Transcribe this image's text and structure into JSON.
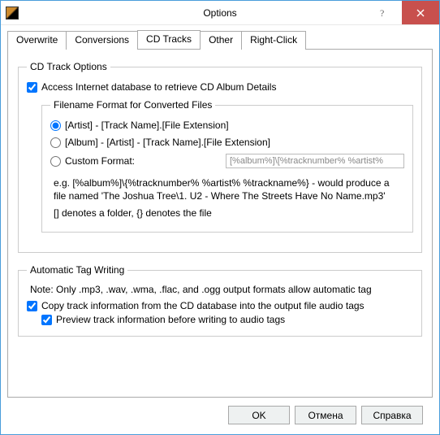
{
  "window": {
    "title": "Options"
  },
  "tabs": {
    "overwrite": "Overwrite",
    "conversions": "Conversions",
    "cdtracks": "CD Tracks",
    "other": "Other",
    "rightclick": "Right-Click",
    "active": "cdtracks"
  },
  "cdtrack": {
    "group_title": "CD Track Options",
    "access_db": "Access Internet database to retrieve CD Album Details",
    "filename_group": "Filename Format for Converted Files",
    "fmt1": "[Artist] - [Track Name].[File Extension]",
    "fmt2": "[Album] - [Artist] - [Track Name].[File Extension]",
    "fmt_custom_label": "Custom Format:",
    "custom_value": "[%album%]\\[%tracknumber% %artist%",
    "eg_line": "e.g. [%album%]\\{%tracknumber% %artist% %trackname%} - would produce a file named 'The Joshua Tree\\1. U2 - Where The Streets Have No Name.mp3'",
    "denotes": "[] denotes a folder, {} denotes the file",
    "autotag_group": "Automatic Tag Writing",
    "note": "Note: Only .mp3, .wav, .wma, .flac, and .ogg output formats allow automatic tag",
    "copy_tags": "Copy track information from the CD database into the output file audio tags",
    "preview_tags": "Preview track information before writing to audio tags"
  },
  "buttons": {
    "ok": "OK",
    "cancel": "Отмена",
    "help": "Справка"
  }
}
